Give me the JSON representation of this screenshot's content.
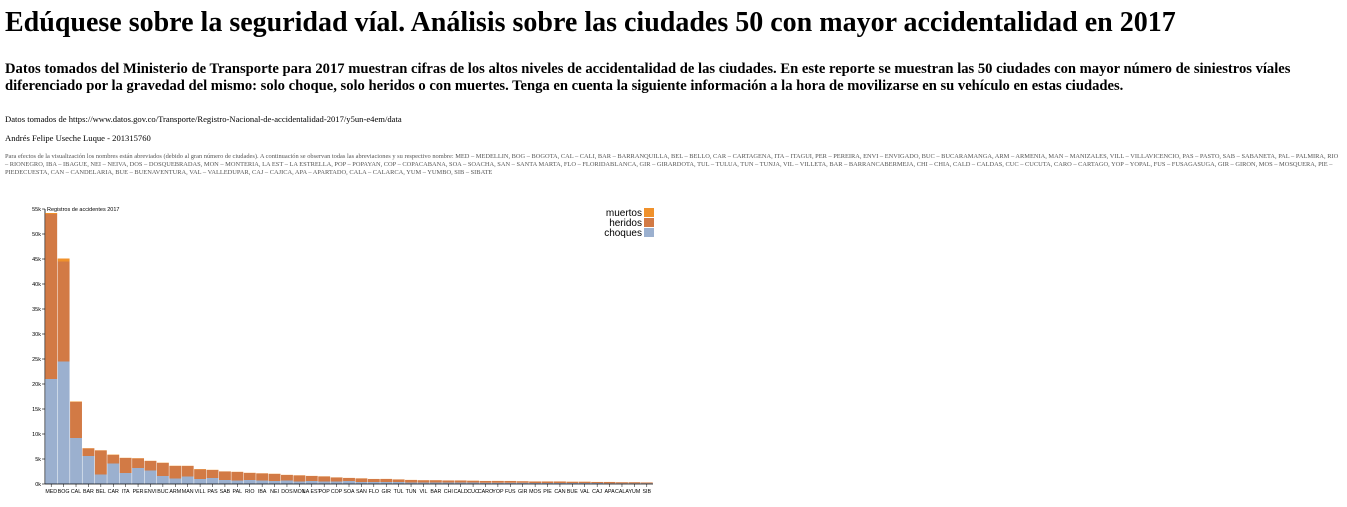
{
  "page": {
    "title": "Edúquese sobre la seguridad víal. Análisis sobre las ciudades 50 con mayor accidentalidad en 2017",
    "subtitle": "Datos tomados del Ministerio de Transporte para 2017 muestran cifras de los altos niveles de accidentalidad de las ciudades. En este reporte se muestran las 50 ciudades con mayor número de siniestros víales diferenciado por la gravedad del mismo: solo choque, solo heridos o con muertes. Tenga en cuenta la siguiente información a la hora de movilizarse en su vehículo en estas ciudades.",
    "source": "Datos tomados de https://www.datos.gov.co/Transporte/Registro-Nacional-de-accidentalidad-2017/y5un-e4em/data",
    "author": "Andrés Felipe Useche Luque - 201315760",
    "note": "Para efectos de la visualización los nombres están abreviados (debido al gran número de ciudades). A continuación se observan todas las abreviaciones y su respectivo nombre: MED – MEDELLIN, BOG – BOGOTA, CAL – CALI, BAR – BARRANQUILLA, BEL – BELLO, CAR – CARTAGENA, ITA – ITAGUI, PER – PEREIRA, ENVI – ENVIGADO, BUC – BUCARAMANGA, ARM – ARMENIA, MAN – MANIZALES, VILL – VILLAVICENCIO, PAS – PASTO, SAB – SABANETA, PAL – PALMIRA, RIO – RIONEGRO, IBA – IBAGUE, NEI – NEIVA, DOS – DOSQUEBRADAS, MON – MONTERIA, LA EST – LA ESTRELLA, POP – POPAYAN, COP – COPACABANA, SOA – SOACHA, SAN – SANTA MARTA, FLO – FLORIDABLANCA, GIR – GIRARDOTA, TUL – TULUA, TUN – TUNJA, VIL – VILLETA, BAR – BARRANCABERMEJA, CHI – CHIA, CALD – CALDAS, CUC – CUCUTA, CARO – CARTAGO, YOP – YOPAL, FUS – FUSAGASUGA, GIR – GIRON, MOS – MOSQUERA, PIE – PIEDECUESTA, CAN – CANDELARIA, BUE – BUENAVENTURA, VAL – VALLEDUPAR, CAJ – CAJICA, APA – APARTADO, CALA – CALARCA, YUM – YUMBO, SIB – SIBATE"
  },
  "chart_data": {
    "type": "bar",
    "stacked": true,
    "title": "Registros de accidentes 2017",
    "xlabel": "",
    "ylabel": "",
    "ylim": [
      0,
      55000
    ],
    "yticks": [
      "0k",
      "5k",
      "10k",
      "15k",
      "20k",
      "25k",
      "30k",
      "35k",
      "40k",
      "45k",
      "50k",
      "55k"
    ],
    "legend_position": "top-right",
    "categories": [
      "MED",
      "BOG",
      "CAL",
      "BAR",
      "BEL",
      "CAR",
      "ITA",
      "PER",
      "ENVI",
      "BUC",
      "ARM",
      "MAN",
      "VILL",
      "PAS",
      "SAB",
      "PAL",
      "RIO",
      "IBA",
      "NEI",
      "DOS",
      "MON",
      "LA EST",
      "POP",
      "COP",
      "SOA",
      "SAN",
      "FLO",
      "GIR",
      "TUL",
      "TUN",
      "VIL",
      "BAR",
      "CHI",
      "CALD",
      "CUC",
      "CARO",
      "YOP",
      "FUS",
      "GIR",
      "MOS",
      "PIE",
      "CAN",
      "BUE",
      "VAL",
      "CAJ",
      "APA",
      "CALA",
      "YUM",
      "SIB"
    ],
    "series": [
      {
        "name": "choques",
        "color": "#9bb0cf",
        "values": [
          21000,
          24500,
          9200,
          5600,
          1900,
          4100,
          2200,
          3200,
          2700,
          1600,
          1100,
          1500,
          1000,
          1200,
          800,
          700,
          800,
          700,
          600,
          700,
          500,
          600,
          500,
          500,
          600,
          400,
          400,
          400,
          400,
          300,
          300,
          300,
          300,
          300,
          300,
          250,
          250,
          250,
          250,
          200,
          200,
          200,
          200,
          200,
          200,
          150,
          150,
          150,
          150
        ]
      },
      {
        "name": "heridos",
        "color": "#d27a45",
        "values": [
          33000,
          20000,
          7200,
          1500,
          4800,
          1700,
          3000,
          1900,
          1900,
          2600,
          2500,
          2100,
          1900,
          1600,
          1700,
          1700,
          1400,
          1400,
          1400,
          1100,
          1200,
          1000,
          1000,
          800,
          600,
          700,
          600,
          600,
          500,
          500,
          450,
          450,
          400,
          400,
          350,
          350,
          350,
          350,
          300,
          300,
          300,
          300,
          250,
          250,
          200,
          250,
          200,
          200,
          150
        ]
      },
      {
        "name": "muertos",
        "color": "#f0912b",
        "values": [
          200,
          600,
          100,
          60,
          40,
          80,
          40,
          60,
          40,
          60,
          50,
          40,
          80,
          40,
          20,
          40,
          40,
          40,
          50,
          30,
          40,
          20,
          30,
          20,
          20,
          30,
          10,
          20,
          20,
          20,
          20,
          20,
          10,
          10,
          30,
          10,
          20,
          10,
          10,
          10,
          10,
          10,
          20,
          20,
          10,
          10,
          10,
          10,
          10
        ]
      }
    ]
  }
}
